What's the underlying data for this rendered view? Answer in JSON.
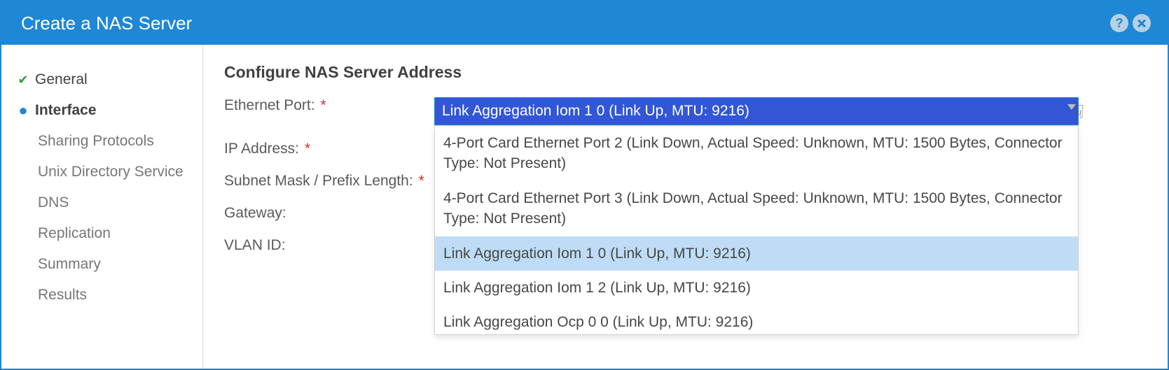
{
  "titlebar": {
    "title": "Create a NAS Server"
  },
  "sidebar": {
    "items": [
      {
        "label": "General",
        "state": "completed"
      },
      {
        "label": "Interface",
        "state": "active"
      },
      {
        "label": "Sharing Protocols",
        "state": "pending"
      },
      {
        "label": "Unix Directory Service",
        "state": "pending"
      },
      {
        "label": "DNS",
        "state": "pending"
      },
      {
        "label": "Replication",
        "state": "pending"
      },
      {
        "label": "Summary",
        "state": "pending"
      },
      {
        "label": "Results",
        "state": "pending"
      }
    ]
  },
  "main": {
    "page_title": "Configure NAS Server Address",
    "fields": {
      "ethernet_port": {
        "label": "Ethernet Port:",
        "required": true
      },
      "ip_address": {
        "label": "IP Address:",
        "required": true
      },
      "subnet": {
        "label": "Subnet Mask / Prefix Length:",
        "required": true
      },
      "gateway": {
        "label": "Gateway:",
        "required": false
      },
      "vlan": {
        "label": "VLAN ID:",
        "required": false
      }
    },
    "ethernet_port_select": {
      "selected": "Link Aggregation Iom 1 0 (Link Up, MTU: 9216)",
      "options": [
        "4-Port Card Ethernet Port 2 (Link Down, Actual Speed: Unknown, MTU: 1500 Bytes, Connector Type: Not Present)",
        "4-Port Card Ethernet Port 3 (Link Down, Actual Speed: Unknown, MTU: 1500 Bytes, Connector Type: Not Present)",
        "Link Aggregation Iom 1 0 (Link Up, MTU: 9216)",
        "Link Aggregation Iom 1 2 (Link Up, MTU: 9216)",
        "Link Aggregation Ocp 0 0 (Link Up, MTU: 9216)"
      ],
      "hover_index": 2
    }
  }
}
